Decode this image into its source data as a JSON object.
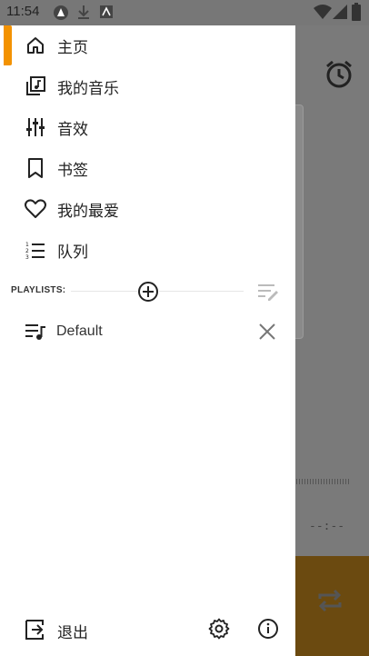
{
  "status_bar": {
    "time": "11:54",
    "left_icons": [
      "autofill-icon",
      "download-icon",
      "app-icon"
    ],
    "right_icons": [
      "wifi-icon",
      "signal-icon",
      "battery-icon"
    ]
  },
  "drawer": {
    "accent_color": "#f39200",
    "nav_items": [
      {
        "label": "主页",
        "icon": "home-icon",
        "active": true
      },
      {
        "label": "我的音乐",
        "icon": "library-music-icon",
        "active": false
      },
      {
        "label": "音效",
        "icon": "equalizer-icon",
        "active": false
      },
      {
        "label": "书签",
        "icon": "bookmark-icon",
        "active": false
      },
      {
        "label": "我的最爱",
        "icon": "heart-icon",
        "active": false
      },
      {
        "label": "队列",
        "icon": "queue-list-icon",
        "active": false
      }
    ],
    "playlists_header": "PLAYLISTS:",
    "playlists": [
      {
        "label": "Default",
        "icon": "playlist-icon"
      }
    ],
    "footer": {
      "exit_label": "退出"
    }
  },
  "background": {
    "time_placeholder": "--:--"
  }
}
